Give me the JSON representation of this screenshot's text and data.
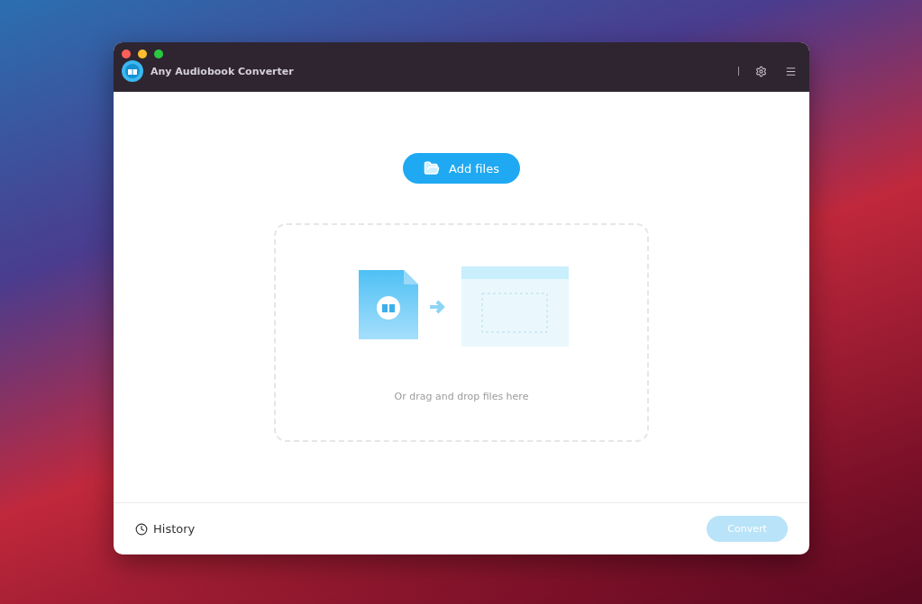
{
  "window": {
    "title": "Any Audiobook Converter"
  },
  "add_button": {
    "label": "Add files"
  },
  "drop_zone": {
    "hint": "Or drag and drop files here"
  },
  "footer": {
    "history": "History",
    "convert": {
      "label": "Convert",
      "disabled": true
    }
  }
}
